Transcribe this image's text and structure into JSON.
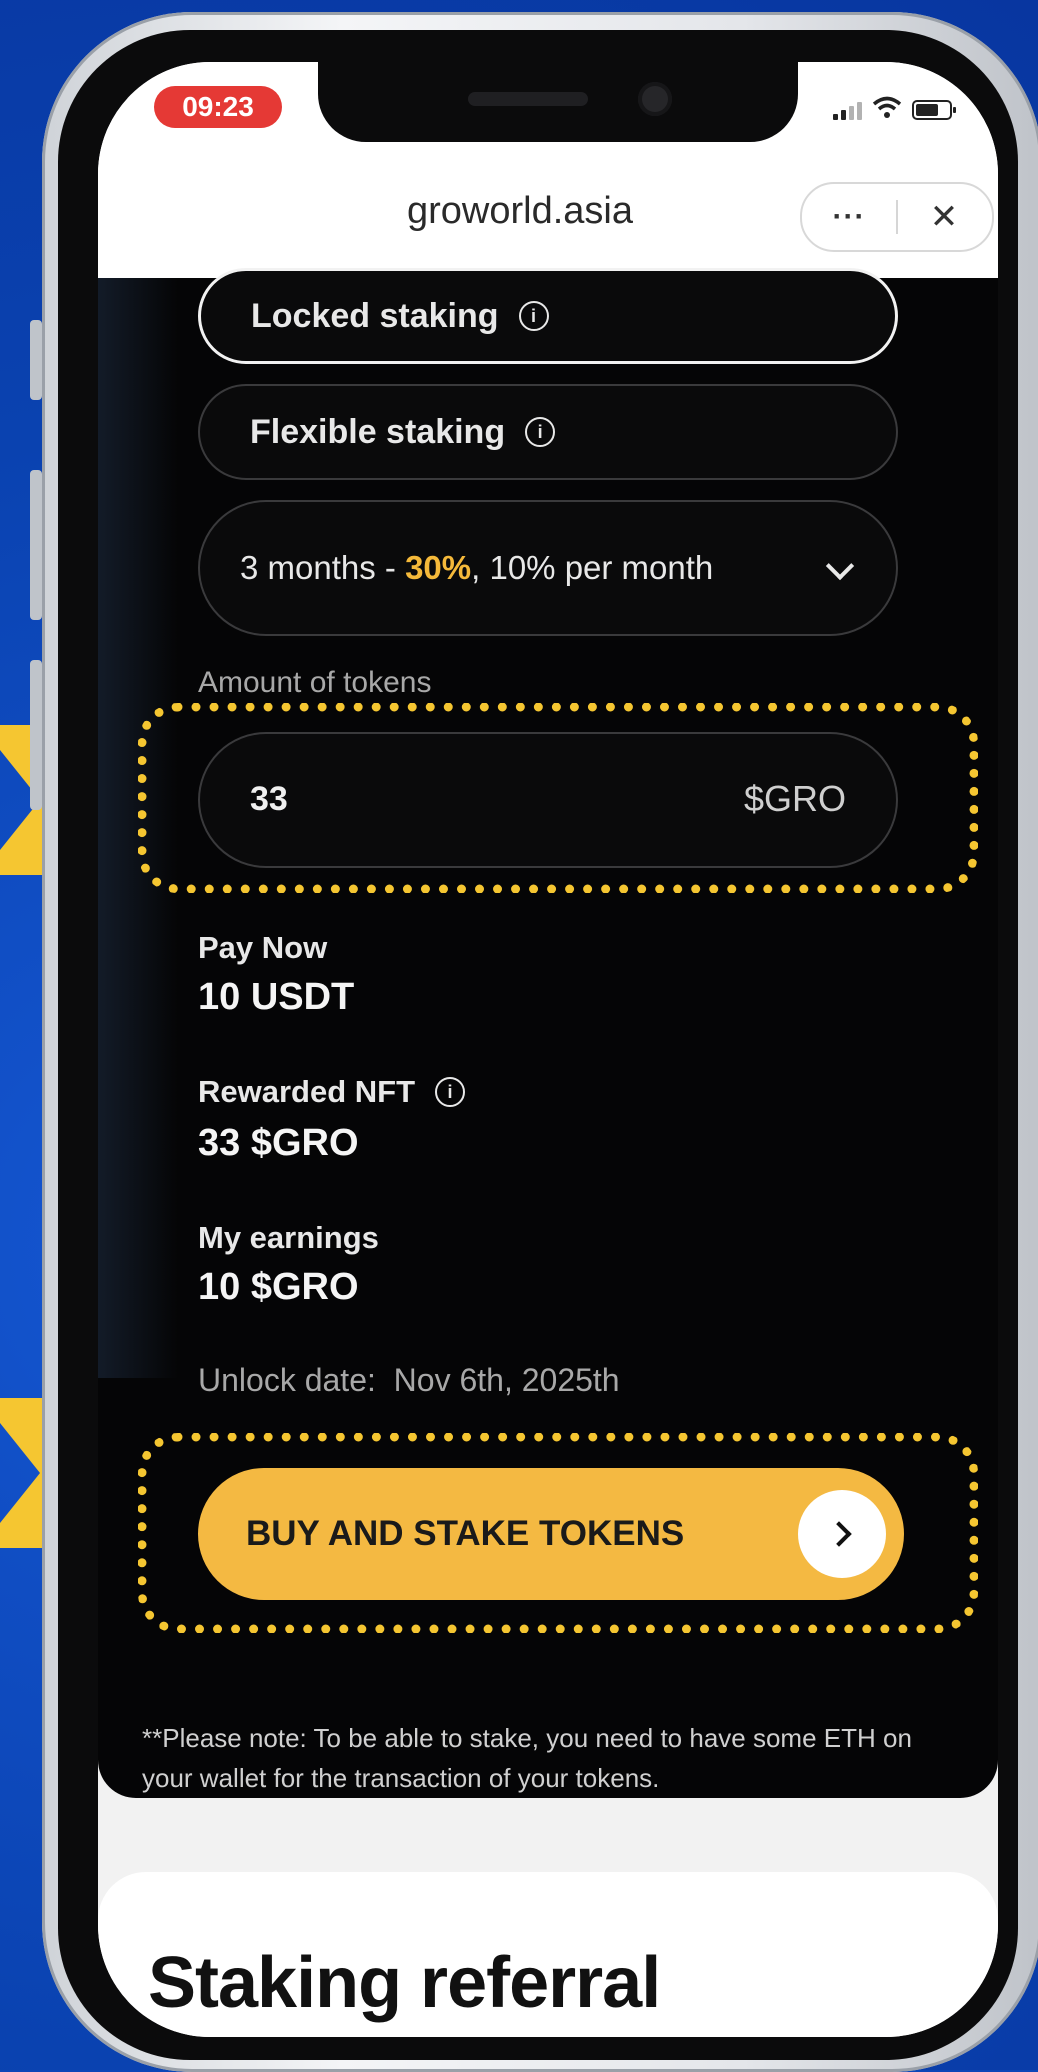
{
  "status_bar": {
    "time": "09:23"
  },
  "browser": {
    "url": "groworld.asia",
    "more_label": "···",
    "close_label": "✕"
  },
  "staking": {
    "options": [
      {
        "label": "Locked staking",
        "selected": true
      },
      {
        "label": "Flexible staking",
        "selected": false
      }
    ],
    "period_select": {
      "prefix": "3 months - ",
      "highlight": "30%",
      "suffix": ", 10% per month"
    },
    "amount": {
      "label": "Amount of tokens",
      "value": "33",
      "unit": "$GRO"
    },
    "pay_now": {
      "label": "Pay Now",
      "value": "10 USDT"
    },
    "rewarded_nft": {
      "label": "Rewarded NFT",
      "value": "33 $GRO"
    },
    "earnings": {
      "label": "My earnings",
      "value": "10 $GRO"
    },
    "unlock": "Unlock date:  Nov 6th, 2025th",
    "buy_button": "BUY AND STAKE TOKENS",
    "note": "**Please note: To be able to stake, you need to have some ETH on your wallet for the transaction of your tokens."
  },
  "referral": {
    "title": "Staking referral"
  },
  "colors": {
    "accent": "#f4b942",
    "highlight": "#f5c631",
    "background": "#0b47b8"
  },
  "icons": [
    "info-icon",
    "chevron-down-icon",
    "chevron-right-icon",
    "signal-icon",
    "wifi-icon",
    "battery-icon"
  ]
}
